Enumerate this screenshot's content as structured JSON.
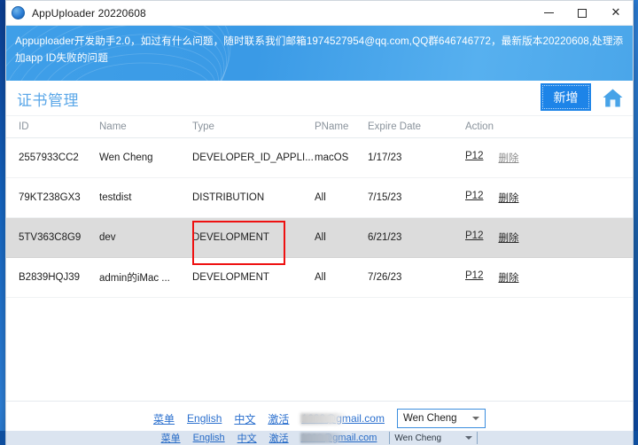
{
  "window": {
    "title": "AppUploader 20220608",
    "app_icon": "app-circle-icon",
    "controls": {
      "minimize": "−",
      "maximize": "□",
      "close": "✕"
    }
  },
  "banner": {
    "text": "Appuploader开发助手2.0，如过有什么问题，随时联系我们邮箱1974527954@qq.com,QQ群646746772，最新版本20220608,处理添加app ID失败的问题",
    "background_color": "#3f9fe8"
  },
  "page_header": {
    "title": "证书管理",
    "add_label": "新增",
    "home_icon": "home-icon",
    "title_color": "#5aa7e8",
    "add_button_color": "#1d84e8"
  },
  "table": {
    "columns": [
      "ID",
      "Name",
      "Type",
      "PName",
      "Expire Date",
      "Action"
    ],
    "rows": [
      {
        "id": "2557933CC2",
        "name": "Wen Cheng",
        "type": "DEVELOPER_ID_APPLI...",
        "pname": "macOS",
        "expire": "1/17/23",
        "action_p12": "P12",
        "action_delete": "删除",
        "selected": false,
        "delete_muted": true
      },
      {
        "id": "79KT238GX3",
        "name": "testdist",
        "type": "DISTRIBUTION",
        "pname": "All",
        "expire": "7/15/23",
        "action_p12": "P12",
        "action_delete": "删除",
        "selected": false,
        "delete_muted": false
      },
      {
        "id": "5TV363C8G9",
        "name": "dev",
        "type": "DEVELOPMENT",
        "pname": "All",
        "expire": "6/21/23",
        "action_p12": "P12",
        "action_delete": "删除",
        "selected": true,
        "delete_muted": false
      },
      {
        "id": "B2839HQJ39",
        "name": "admin的iMac ...",
        "type": "DEVELOPMENT",
        "pname": "All",
        "expire": "7/26/23",
        "action_p12": "P12",
        "action_delete": "删除",
        "selected": false,
        "delete_muted": false
      }
    ],
    "selected_row_bg": "#dcdcdc"
  },
  "annotation": {
    "shape": "rectangle",
    "color": "#ee1111",
    "targets": "type-cell-of-selected-row"
  },
  "footer": {
    "links": [
      "菜单",
      "English",
      "中文",
      "激活"
    ],
    "email": "1688@gmail.com",
    "email_redacted": true,
    "user_select_value": "Wen Cheng",
    "link_color": "#2a6fce",
    "select_border_color": "#3b8ede"
  }
}
